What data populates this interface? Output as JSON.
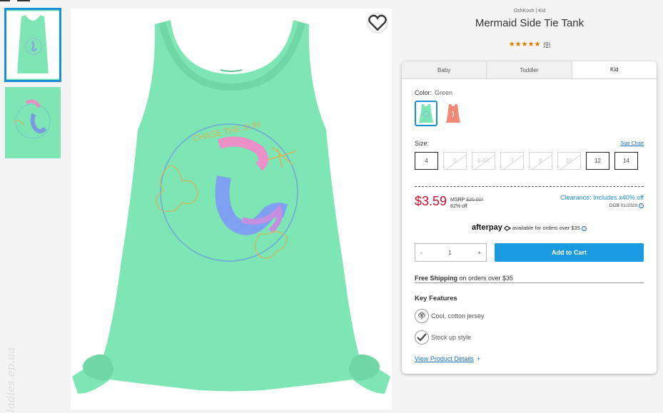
{
  "product": {
    "brand": "OshKosh | Kid",
    "title": "Mermaid Side Tie Tank",
    "stars": "★★★★★",
    "rating_value": 5,
    "review_count": "(9)",
    "graphic_text": "CHASE THE SUN"
  },
  "tabs": [
    {
      "label": "Baby"
    },
    {
      "label": "Toddler"
    },
    {
      "label": "Kid"
    }
  ],
  "color": {
    "label": "Color:",
    "value": "Green"
  },
  "size": {
    "label": "Size:",
    "chart_link": "Size Chart",
    "options": [
      "4",
      "5",
      "6-6X",
      "7",
      "8",
      "10",
      "12",
      "14"
    ]
  },
  "price": {
    "current": "$3.59",
    "msrp_label": "MSRP",
    "msrp_value": "$20.00*",
    "discount": "82% off",
    "clearance": "Clearance: Includes x40% off",
    "dob": "DOB 01/2020"
  },
  "afterpay": {
    "logo": "afterpay",
    "text": "available for orders over $35"
  },
  "quantity": {
    "minus": "-",
    "value": "1",
    "plus": "+"
  },
  "cart": {
    "button": "Add to Cart"
  },
  "shipping": {
    "bold": "Free Shipping",
    "rest": " on orders over $35"
  },
  "features": {
    "heading": "Key Features",
    "items": [
      {
        "label": "Cool, cotton jersey"
      },
      {
        "label": "Stock up style"
      }
    ],
    "details_link": "View Product Details",
    "details_plus": "+"
  },
  "watermark": "ladies.ep.ua",
  "colors": {
    "accent": "#1a9ae0",
    "sale": "#c8102e",
    "tank_green": "#7de6b4",
    "swatch_coral": "#f08a76",
    "star": "#e07b00"
  }
}
